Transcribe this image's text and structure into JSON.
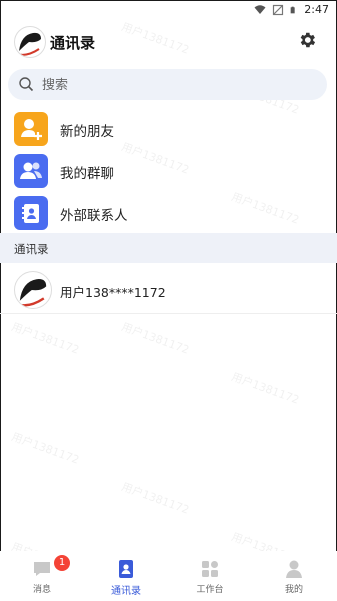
{
  "status_bar": {
    "time": "2:47"
  },
  "header": {
    "title": "通讯录"
  },
  "search": {
    "placeholder": "搜索"
  },
  "menu": [
    {
      "label": "新的朋友",
      "color": "#f7a51c",
      "icon": "add-friend-icon"
    },
    {
      "label": "我的群聊",
      "color": "#4a6cf0",
      "icon": "group-icon"
    },
    {
      "label": "外部联系人",
      "color": "#4a6cf0",
      "icon": "contact-book-icon"
    }
  ],
  "section_title": "通讯录",
  "contacts": [
    {
      "name": "用户138****1172"
    }
  ],
  "tabs": [
    {
      "label": "消息",
      "badge": "1",
      "icon": "message-icon"
    },
    {
      "label": "通讯录",
      "icon": "contacts-icon",
      "active": true
    },
    {
      "label": "工作台",
      "icon": "workbench-icon"
    },
    {
      "label": "我的",
      "icon": "profile-icon"
    }
  ],
  "watermark_text": "用户1381172"
}
